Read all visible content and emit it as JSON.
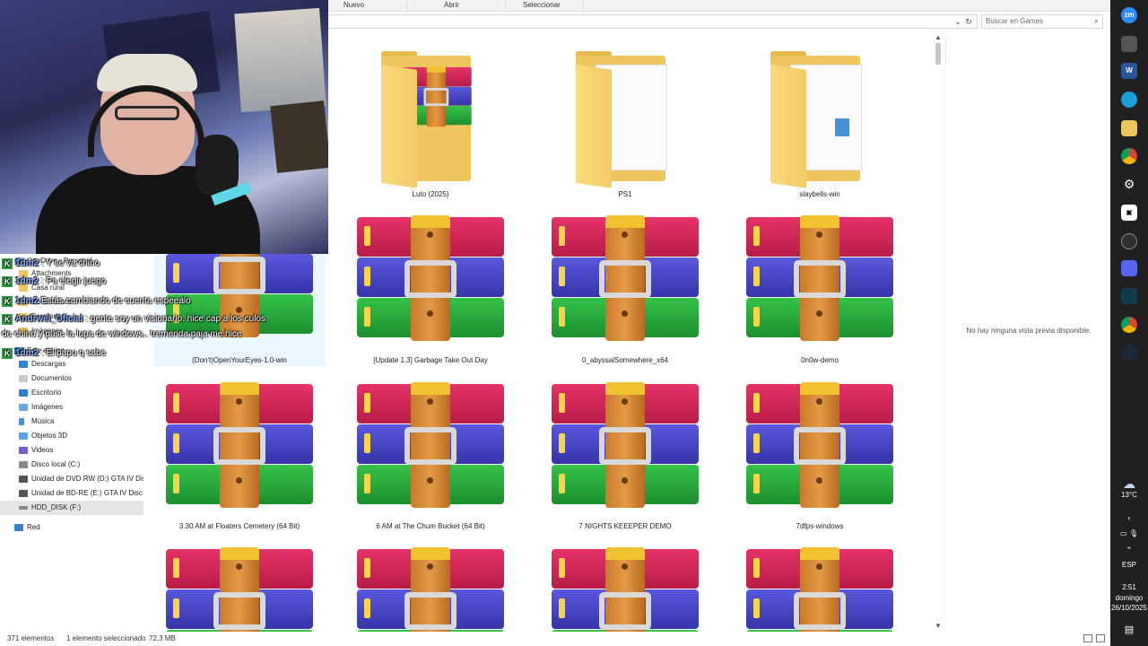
{
  "ribbon": {
    "new_label": "Nuevo",
    "open_label": "Abrir",
    "select_label": "Seleccionar"
  },
  "search": {
    "placeholder": "Buscar en Games"
  },
  "nav": {
    "items": [
      {
        "label": "OneDrive - Personal",
        "icon": "cloud-icon"
      },
      {
        "label": "Attachments",
        "icon": "folder-icon"
      },
      {
        "label": "Casa rural",
        "icon": "folder-icon"
      },
      {
        "label": "Documentos",
        "icon": "folder-icon"
      },
      {
        "label": "Escritorio",
        "icon": "folder-icon"
      },
      {
        "label": "Imágenes",
        "icon": "folder-icon"
      },
      {
        "label": "Este equipo",
        "icon": "computer-icon"
      },
      {
        "label": "Descargas",
        "icon": "download-icon"
      },
      {
        "label": "Documentos",
        "icon": "documents-icon"
      },
      {
        "label": "Escritorio",
        "icon": "desktop-icon"
      },
      {
        "label": "Imágenes",
        "icon": "pictures-icon"
      },
      {
        "label": "Música",
        "icon": "music-icon"
      },
      {
        "label": "Objetos 3D",
        "icon": "cube-icon"
      },
      {
        "label": "Videos",
        "icon": "video-icon"
      },
      {
        "label": "Disco local (C:)",
        "icon": "drive-icon"
      },
      {
        "label": "Unidad de DVD RW (D:) GTA IV Disc",
        "icon": "dvd-icon"
      },
      {
        "label": "Unidad de BD-RE (E:) GTA IV Disc 1",
        "icon": "dvd-icon"
      },
      {
        "label": "HDD_DISK (F:)",
        "icon": "drive-icon"
      },
      {
        "label": "Red",
        "icon": "network-icon"
      }
    ]
  },
  "chat": [
    {
      "badge": "K",
      "user": "1dm2",
      "message": ": Y se va chino"
    },
    {
      "badge": "K",
      "user": "1dm2",
      "message": ": Pa elegir juego"
    },
    {
      "badge": "K",
      "user": "1dm2",
      "message": "Estás cambiando de cuenta espeealo"
    },
    {
      "badge": "K",
      "user": "Andrwel_Oficial",
      "message": ": gente soy un visionario. hice cap a los culos"
    },
    {
      "badge": "",
      "user": "",
      "message": "de chino y puse la lupa de windows.. tremenda paja me hice"
    },
    {
      "badge": "K",
      "user": "1dm2",
      "message": ": El papu q sabe"
    }
  ],
  "files": [
    {
      "name": "Luto (2025)",
      "type": "folder-rar"
    },
    {
      "name": "PS1",
      "type": "folder-docs"
    },
    {
      "name": "slaybells-win",
      "type": "folder-docs"
    },
    {
      "name": "(Don't)OpenYourEyes-1.0-win",
      "type": "rar"
    },
    {
      "name": "[Update 1.3] Garbage Take Out Day",
      "type": "rar"
    },
    {
      "name": "0_abyssalSomewhere_x64",
      "type": "rar"
    },
    {
      "name": "0n0w-demo",
      "type": "rar"
    },
    {
      "name": "3.30 AM at Floaters Cemetery (64 Bit)",
      "type": "rar"
    },
    {
      "name": "6 AM at The Chum Bucket (64 Bit)",
      "type": "rar"
    },
    {
      "name": "7 NIGHTS KEEEPER DEMO",
      "type": "rar"
    },
    {
      "name": "7dfps-windows",
      "type": "rar"
    },
    {
      "name": "",
      "type": "rar"
    },
    {
      "name": "",
      "type": "rar"
    },
    {
      "name": "",
      "type": "rar"
    },
    {
      "name": "",
      "type": "rar"
    }
  ],
  "preview": {
    "message": "No hay ninguna vista previa disponible."
  },
  "status": {
    "count": "371 elementos",
    "selection": "1 elemento seleccionado",
    "size": "72,3 MB"
  },
  "taskbar": {
    "apps": [
      "zoom-icon",
      "app-icon",
      "word-icon",
      "edge-icon",
      "explorer-icon",
      "chrome-icon",
      "settings-icon",
      "capcut-icon",
      "obs-icon",
      "discord-icon",
      "terminal-icon",
      "chrome-icon",
      "steam-icon"
    ],
    "weather_temp": "13°C",
    "language": "ESP",
    "time": "2:51",
    "day": "domingo",
    "date": "26/10/2025"
  }
}
